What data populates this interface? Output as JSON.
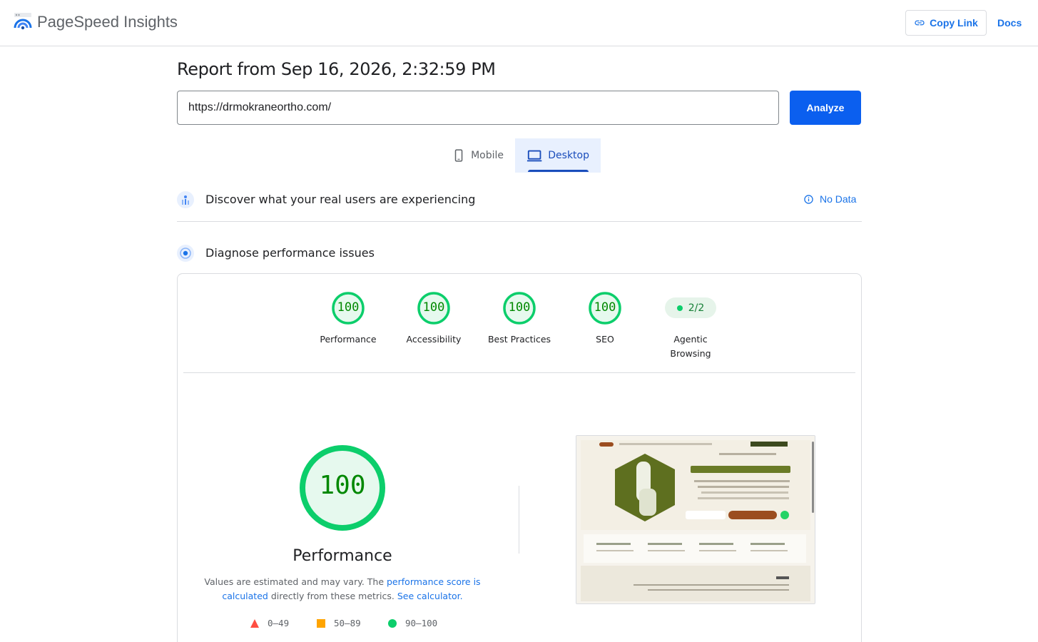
{
  "header": {
    "app_title": "PageSpeed Insights",
    "copy_link_label": "Copy Link",
    "docs_label": "Docs"
  },
  "report": {
    "title": "Report from Sep 16, 2026, 2:32:59 PM",
    "url_value": "https://drmokraneortho.com/",
    "analyze_label": "Analyze"
  },
  "tabs": [
    {
      "label": "Mobile",
      "selected": false
    },
    {
      "label": "Desktop",
      "selected": true
    }
  ],
  "real_users": {
    "title": "Discover what your real users are experiencing",
    "status": "No Data"
  },
  "diagnose": {
    "title": "Diagnose performance issues"
  },
  "scores": [
    {
      "value": "100",
      "label": "Performance"
    },
    {
      "value": "100",
      "label": "Accessibility"
    },
    {
      "value": "100",
      "label": "Best Practices"
    },
    {
      "value": "100",
      "label": "SEO"
    }
  ],
  "agentic": {
    "value": "2/2",
    "label_line1": "Agentic",
    "label_line2": "Browsing"
  },
  "performance": {
    "score": "100",
    "title": "Performance",
    "text_1": "Values are estimated and may vary. The ",
    "link_1": "performance score is calculated",
    "text_2": " directly from these metrics. ",
    "link_2": "See calculator.",
    "legend": [
      {
        "range": "0–49",
        "color": "#ff4e42",
        "shape": "triangle"
      },
      {
        "range": "50–89",
        "color": "#ffa400",
        "shape": "square"
      },
      {
        "range": "90–100",
        "color": "#0cce6b",
        "shape": "circle"
      }
    ]
  },
  "colors": {
    "accent": "#1a73e8",
    "good": "#0cce6b",
    "good_text": "#008800"
  }
}
